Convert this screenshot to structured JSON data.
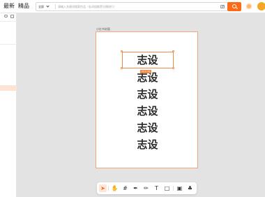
{
  "topnav": {
    "latest": "最新",
    "featured": "精品"
  },
  "search": {
    "scope": "全部",
    "placeholder": "请输入关键词搜索作品（长词组推荐分隔进行）"
  },
  "artboard": {
    "title": "小红书封面",
    "lines": [
      "志设",
      "志设",
      "志设",
      "志设",
      "志设",
      "志设"
    ],
    "selection_size": "73 × 24"
  },
  "toolbar": {
    "icons": [
      "pointer-icon",
      "hand-icon",
      "frame-icon",
      "pen-icon",
      "pencil-icon",
      "text-icon",
      "rectangle-icon",
      "image-icon",
      "plugin-icon"
    ],
    "glyphs": [
      "➤",
      "✋",
      "#",
      "✒",
      "✏",
      "T",
      "□",
      "▣",
      "♣"
    ]
  },
  "colors": {
    "accent": "#ff6a16",
    "selection": "#f08a4b",
    "canvas": "#e3e3e3"
  }
}
